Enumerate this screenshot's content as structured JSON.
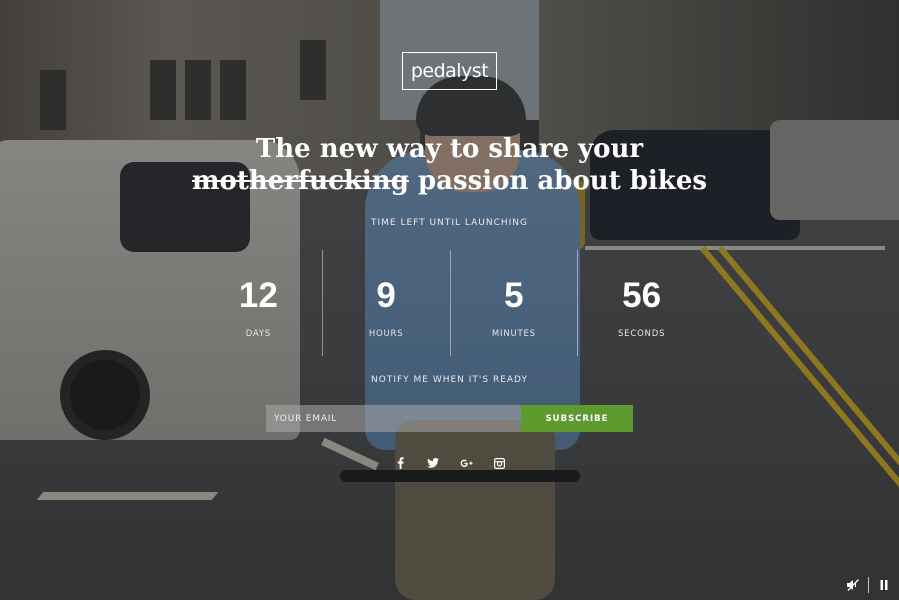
{
  "brand": {
    "logo_text": "pedalyst"
  },
  "headline": {
    "line1": "The new way to share your",
    "struck_word": "motherfucking",
    "line2_rest": " passion about bikes"
  },
  "countdown": {
    "caption": "TIME LEFT UNTIL LAUNCHING",
    "units": [
      {
        "value": "12",
        "label": "DAYS"
      },
      {
        "value": "9",
        "label": "HOURS"
      },
      {
        "value": "5",
        "label": "MINUTES"
      },
      {
        "value": "56",
        "label": "SECONDS"
      }
    ]
  },
  "notify": {
    "caption": "NOTIFY ME WHEN IT'S READY",
    "email_placeholder": "YOUR EMAIL",
    "email_value": "",
    "subscribe_label": "SUBSCRIBE",
    "button_color": "#5e9b2f"
  },
  "social": [
    {
      "name": "facebook-icon",
      "glyph": "f"
    },
    {
      "name": "twitter-icon",
      "glyph": "bird"
    },
    {
      "name": "google-plus-icon",
      "glyph": "g+"
    },
    {
      "name": "instagram-icon",
      "glyph": "camera"
    }
  ],
  "video_controls": [
    {
      "name": "mute-icon"
    },
    {
      "name": "pause-icon"
    }
  ]
}
